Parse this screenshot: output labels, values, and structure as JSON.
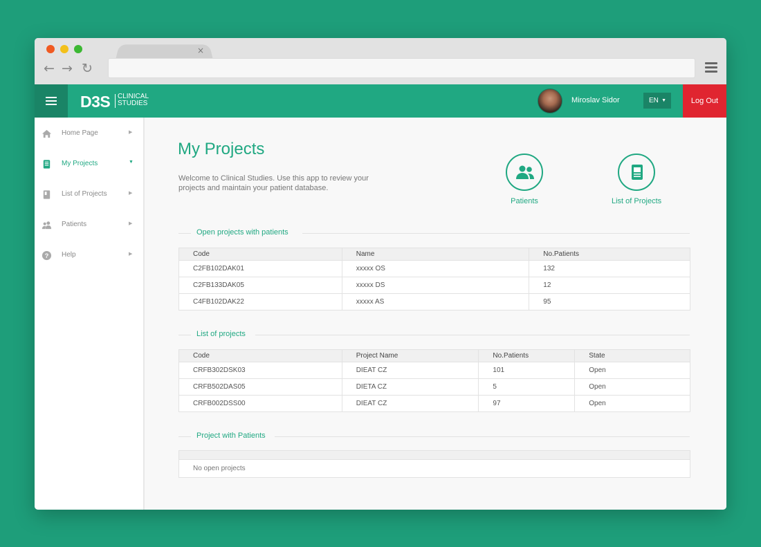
{
  "browser": {
    "tab_close": "×",
    "back": "←",
    "forward": "→",
    "reload": "↻"
  },
  "header": {
    "logo_main": "D3S",
    "logo_sub_1": "CLINICAL",
    "logo_sub_2": "STUDIES",
    "user_name": "Miroslav Sidor",
    "language": "EN",
    "logout_label": "Log Out"
  },
  "sidebar": {
    "items": [
      {
        "label": "Home Page",
        "icon": "home-icon",
        "active": false
      },
      {
        "label": "My Projects",
        "icon": "tablet-icon",
        "active": true
      },
      {
        "label": "List of Projects",
        "icon": "book-icon",
        "active": false
      },
      {
        "label": "Patients",
        "icon": "people-icon",
        "active": false
      },
      {
        "label": "Help",
        "icon": "help-icon",
        "active": false
      }
    ]
  },
  "main": {
    "title": "My Projects",
    "welcome": "Welcome to Clinical Studies. Use this app to review your projects and maintain your patient database.",
    "quick_links": [
      {
        "label": "Patients",
        "icon": "people-icon"
      },
      {
        "label": "List of Projects",
        "icon": "document-icon"
      }
    ],
    "open_projects": {
      "title": "Open projects with patients",
      "headers": [
        "Code",
        "Name",
        "No.Patients"
      ],
      "rows": [
        [
          "C2FB102DAK01",
          "xxxxx OS",
          "132"
        ],
        [
          "C2FB133DAK05",
          "xxxxx DS",
          "12"
        ],
        [
          "C4FB102DAK22",
          "xxxxx AS",
          "95"
        ]
      ]
    },
    "list_projects": {
      "title": "List of projects",
      "headers": [
        "Code",
        "Project Name",
        "No.Patients",
        "State"
      ],
      "rows": [
        [
          "CRFB302DSK03",
          "DIEAT CZ",
          "101",
          "Open"
        ],
        [
          "CRFB502DAS05",
          "DIETA CZ",
          "5",
          "Open"
        ],
        [
          "CRFB002DSS00",
          "DIEAT CZ",
          "97",
          "Open"
        ]
      ]
    },
    "project_patients": {
      "title": "Project with Patients",
      "empty_message": "No open projects"
    }
  },
  "colors": {
    "background": "#1e9e7a",
    "accent": "#20a882",
    "accent_dark": "#1a8466",
    "logout": "#e02530"
  }
}
